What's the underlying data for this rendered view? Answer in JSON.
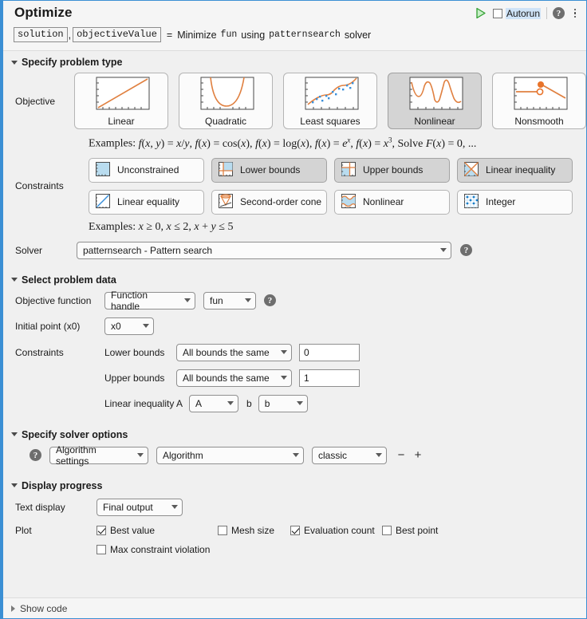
{
  "header": {
    "title": "Optimize",
    "run_icon": "run-triangle-icon",
    "autorun_label": "Autorun",
    "autorun_checked": false,
    "help_icon": "help-icon",
    "menu_icon": "kebab-menu-icon",
    "summary": {
      "output1": "solution",
      "comma": ",",
      "output2": "objectiveValue",
      "equals": "=",
      "verb": "Minimize",
      "fun": "fun",
      "using": "using",
      "solver": "patternsearch",
      "solver_suffix": "solver"
    }
  },
  "problem_type": {
    "section_label": "Specify problem type",
    "objective_label": "Objective",
    "objective_tiles": [
      {
        "label": "Linear",
        "icon": "linear-plot-icon",
        "selected": false
      },
      {
        "label": "Quadratic",
        "icon": "quadratic-plot-icon",
        "selected": false
      },
      {
        "label": "Least squares",
        "icon": "least-squares-plot-icon",
        "selected": false
      },
      {
        "label": "Nonlinear",
        "icon": "nonlinear-plot-icon",
        "selected": true
      },
      {
        "label": "Nonsmooth",
        "icon": "nonsmooth-plot-icon",
        "selected": false
      }
    ],
    "objective_examples_prefix": "Examples:",
    "constraints_label": "Constraints",
    "constraint_chips": [
      {
        "label": "Unconstrained",
        "icon": "unconstrained-icon",
        "selected": false
      },
      {
        "label": "Lower bounds",
        "icon": "lower-bounds-icon",
        "selected": true
      },
      {
        "label": "Upper bounds",
        "icon": "upper-bounds-icon",
        "selected": true
      },
      {
        "label": "Linear inequality",
        "icon": "linear-inequality-icon",
        "selected": true
      },
      {
        "label": "Linear equality",
        "icon": "linear-equality-icon",
        "selected": false
      },
      {
        "label": "Second-order cone",
        "icon": "second-order-cone-icon",
        "selected": false
      },
      {
        "label": "Nonlinear",
        "icon": "nonlinear-constraint-icon",
        "selected": false
      },
      {
        "label": "Integer",
        "icon": "integer-icon",
        "selected": false
      }
    ],
    "constraints_examples_prefix": "Examples:",
    "solver_label": "Solver",
    "solver_value": "patternsearch - Pattern search"
  },
  "problem_data": {
    "section_label": "Select problem data",
    "objective_function_label": "Objective function",
    "objective_function_type": "Function handle",
    "objective_function_value": "fun",
    "initial_point_label": "Initial point (x0)",
    "initial_point_value": "x0",
    "constraints_label": "Constraints",
    "lower_bounds_label": "Lower bounds",
    "lower_bounds_mode": "All bounds the same",
    "lower_bounds_value": "0",
    "upper_bounds_label": "Upper bounds",
    "upper_bounds_mode": "All bounds the same",
    "upper_bounds_value": "1",
    "linear_inequality_label": "Linear inequality",
    "linear_inequality_A_label": "A",
    "linear_inequality_A_value": "A",
    "linear_inequality_b_label": "b",
    "linear_inequality_b_value": "b"
  },
  "solver_options": {
    "section_label": "Specify solver options",
    "group_value": "Algorithm settings",
    "option_value": "Algorithm",
    "value_value": "classic",
    "remove_label": "−",
    "add_label": "+"
  },
  "display_progress": {
    "section_label": "Display progress",
    "text_display_label": "Text display",
    "text_display_value": "Final output",
    "plot_label": "Plot",
    "plot_options": [
      {
        "label": "Best value",
        "checked": true
      },
      {
        "label": "Mesh size",
        "checked": false
      },
      {
        "label": "Evaluation count",
        "checked": true
      },
      {
        "label": "Best point",
        "checked": false
      },
      {
        "label": "Max constraint violation",
        "checked": false
      }
    ]
  },
  "footer": {
    "show_code_label": "Show code"
  },
  "colors": {
    "accent_border": "#3b8fd4",
    "plot_orange": "#e08040",
    "plot_blue": "#3a8fd9",
    "fill_blue": "#b9dcef",
    "run_green": "#2f9e2f",
    "panel_bg": "#f0f0f0",
    "selected_tile": "#d4d4d4"
  }
}
